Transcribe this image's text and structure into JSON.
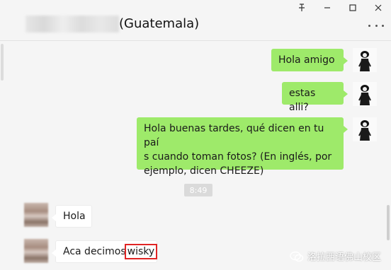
{
  "window": {
    "pin_glyph": "ꟼ",
    "minimize": "—",
    "maximize": "☐",
    "close": "✕"
  },
  "header": {
    "title": "(Guatemala)"
  },
  "messages": [
    {
      "side": "out",
      "text": "Hola amigo"
    },
    {
      "side": "out",
      "text": "estas alli?"
    },
    {
      "side": "out",
      "text_lines": [
        "Hola buenas tardes, qué dicen en tu paí",
        "s cuando toman fotos? (En inglés, por",
        "ejemplo, dicen CHEEZE)"
      ]
    },
    {
      "side": "in",
      "text": "Hola"
    },
    {
      "side": "in",
      "text_prefix": "Aca decimos",
      "text_highlight": "wisky"
    }
  ],
  "timestamp": "8:49",
  "watermark": {
    "text": "洛拉西语佛山校区"
  },
  "colors": {
    "outgoing_bubble": "#9eea6a",
    "incoming_bubble": "#ffffff",
    "highlight_box": "#e02424",
    "background": "#f5f5f5"
  },
  "icons": {
    "pin": "pin-icon",
    "minimize": "minimize-icon",
    "maximize": "maximize-icon",
    "close": "close-icon",
    "more": "more-options-icon",
    "watermark_logo": "wechat-logo-icon"
  }
}
